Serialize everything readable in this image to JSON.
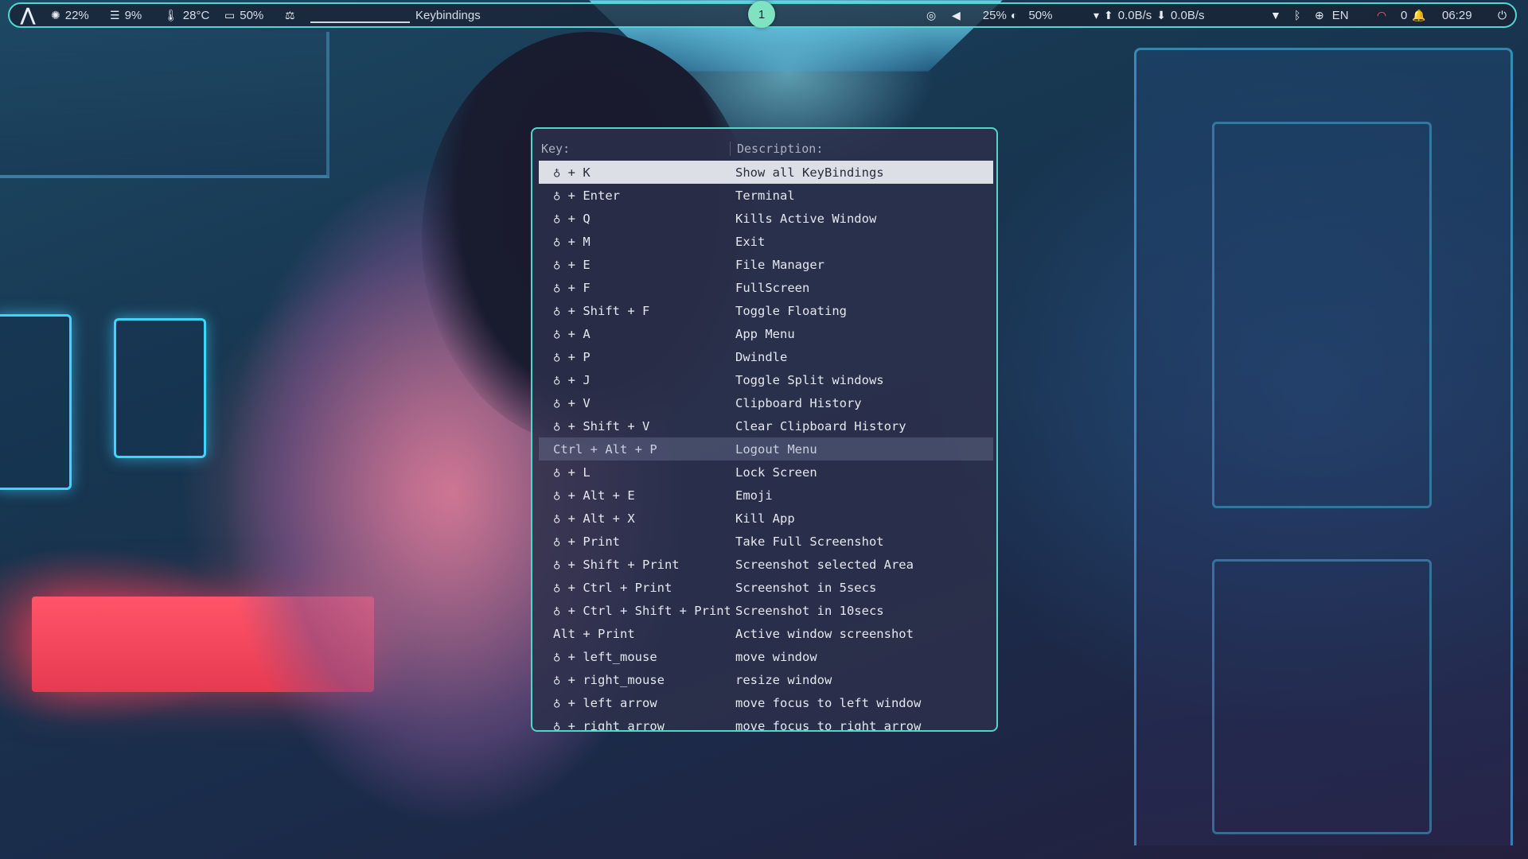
{
  "topbar": {
    "logo_icon": "arch-logo-icon",
    "cpu": "22%",
    "memory": "9%",
    "temperature": "28°C",
    "battery": "50%",
    "window_title": "Keybindings",
    "workspace": "1",
    "volume": "25%",
    "brightness": "50%",
    "net_up": "0.0B/s",
    "net_down": "0.0B/s",
    "language": "EN",
    "notifications": "0",
    "clock": "06:29"
  },
  "keybindings": {
    "header_key": "Key:",
    "header_desc": "Description:",
    "super_glyph": "♁",
    "rows": [
      {
        "key": "♁ + K",
        "desc": "Show all KeyBindings"
      },
      {
        "key": "♁ + Enter",
        "desc": "Terminal"
      },
      {
        "key": "♁ + Q",
        "desc": "Kills Active Window"
      },
      {
        "key": "♁ + M",
        "desc": "Exit"
      },
      {
        "key": "♁ + E",
        "desc": "File Manager"
      },
      {
        "key": "♁ + F",
        "desc": "FullScreen"
      },
      {
        "key": "♁ + Shift + F",
        "desc": "Toggle Floating"
      },
      {
        "key": "♁ + A",
        "desc": "App Menu"
      },
      {
        "key": "♁ + P",
        "desc": "Dwindle"
      },
      {
        "key": "♁ + J",
        "desc": "Toggle Split windows"
      },
      {
        "key": "♁ + V",
        "desc": "Clipboard History"
      },
      {
        "key": "♁ + Shift + V",
        "desc": "Clear Clipboard History"
      },
      {
        "key": "Ctrl + Alt + P",
        "desc": "Logout Menu"
      },
      {
        "key": "♁ + L",
        "desc": "Lock Screen"
      },
      {
        "key": "♁ + Alt + E",
        "desc": "Emoji"
      },
      {
        "key": "♁ + Alt + X",
        "desc": "Kill App"
      },
      {
        "key": "♁ + Print",
        "desc": "Take Full Screenshot"
      },
      {
        "key": "♁ + Shift + Print",
        "desc": "Screenshot selected Area"
      },
      {
        "key": "♁ + Ctrl + Print",
        "desc": "Screenshot in 5secs"
      },
      {
        "key": "♁ + Ctrl + Shift + Print",
        "desc": "Screenshot in 10secs"
      },
      {
        "key": "Alt + Print",
        "desc": "Active window screenshot"
      },
      {
        "key": "♁ + left_mouse",
        "desc": "move window"
      },
      {
        "key": "♁ + right_mouse",
        "desc": "resize window"
      },
      {
        "key": "♁ + left arrow",
        "desc": "move focus to left window"
      },
      {
        "key": "♁ + right arrow",
        "desc": "move focus to right arrow"
      }
    ]
  }
}
